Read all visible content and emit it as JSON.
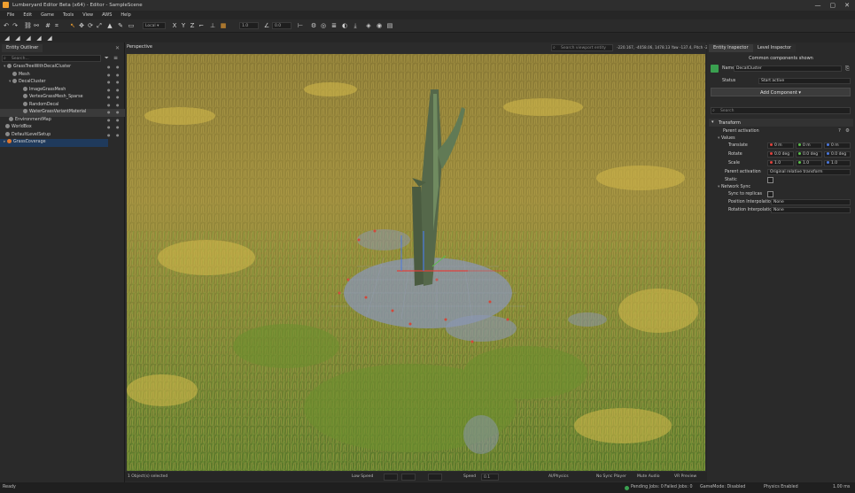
{
  "window": {
    "title": "Lumberyard Editor Beta (x64) - Editor - SampleScene",
    "controls": [
      "—",
      "▢",
      "✕"
    ]
  },
  "menu": [
    "File",
    "Edit",
    "Game",
    "Tools",
    "View",
    "AWS",
    "Help"
  ],
  "toolbar": {
    "snap_value": "0.0",
    "angle_value": "0.0",
    "grid_value": "1.0"
  },
  "entity_outliner": {
    "tab_label": "Entity Outliner",
    "search_placeholder": "Search...",
    "items": [
      {
        "label": "GrassTreeWithDecalCluster",
        "depth": 0
      },
      {
        "label": "Mesh",
        "depth": 1
      },
      {
        "label": "DecalCluster",
        "depth": 1
      },
      {
        "label": "ImageGrassMesh",
        "depth": 2
      },
      {
        "label": "VertexGrassMesh_Sparse",
        "depth": 2
      },
      {
        "label": "RandomDecal",
        "depth": 2
      },
      {
        "label": "WaterGrassVariantMaterial",
        "depth": 2
      },
      {
        "label": "EnvironmentMap",
        "depth": 0
      },
      {
        "label": "WorldBox",
        "depth": 0
      },
      {
        "label": "DefaultLevelSetup",
        "depth": 0
      },
      {
        "label": "GrassCoverage",
        "depth": 0
      }
    ]
  },
  "viewport": {
    "tab_label": "Perspective",
    "search_placeholder": "Search viewport entity",
    "camera_text": "-220.167, -4058.06, 1478.13 Yaw -137.4, Pitch -20.3",
    "status_text": "1 Object(s) selected",
    "status_right": [
      "Low Speed",
      "Speed",
      "0.1",
      "AI/Physics",
      "No Sync Player",
      "Mute Audio",
      "VR Preview"
    ]
  },
  "inspector": {
    "tabs": [
      "Entity Inspector",
      "Level Inspector"
    ],
    "header": "Common components shown",
    "name_label": "Name",
    "name_value": "DecalCluster",
    "status_label": "Status",
    "status_value": "Start active",
    "add_component_label": "Add Component ▾",
    "search_placeholder": "Search",
    "transform": {
      "title": "Transform",
      "parent_activation_label": "Parent activation",
      "values_label": "Values",
      "translate_label": "Translate",
      "translate": [
        "0 m",
        "0 m",
        "0 m"
      ],
      "rotate_label": "Rotate",
      "rotate": [
        "0.0 deg",
        "0.0 deg",
        "0.0 deg"
      ],
      "scale_label": "Scale",
      "scale": [
        "1.0",
        "1.0",
        "1.0"
      ],
      "parent_activation_value": "Original relative transform",
      "static_label": "Static",
      "network_sync_label": "Network Sync",
      "sync_label": "Sync to replicas",
      "position_interp_label": "Position Interpolation",
      "position_interp_value": "None",
      "rotation_interp_label": "Rotation Interpolation",
      "rotation_interp_value": "None"
    },
    "axis_colors": {
      "x": "#e0413c",
      "y": "#5cbf4b",
      "z": "#4a79e0"
    }
  },
  "statusbar": {
    "left": "Ready",
    "items": [
      "Pending Jobs: 0",
      "Failed Jobs: 0",
      "GameMode: Disabled",
      "Physics Enabled"
    ],
    "right": "1.00 ms"
  },
  "colors": {
    "accent_selected": "#1f3a5c",
    "grass_dark": "#4f6b2a",
    "grass_light": "#c8b35a"
  }
}
